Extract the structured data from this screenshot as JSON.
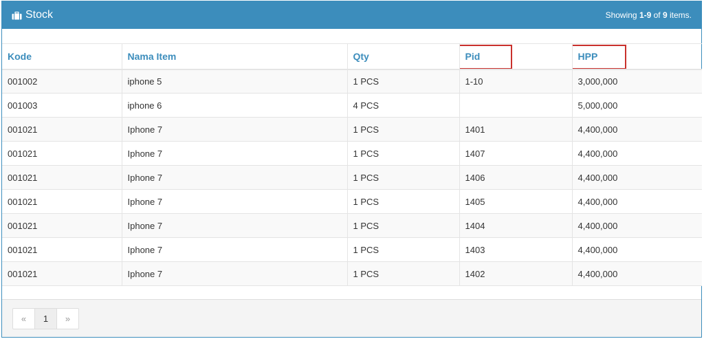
{
  "panel": {
    "title": "Stock",
    "icon": "briefcase-icon",
    "summary": {
      "prefix": "Showing ",
      "range": "1-9",
      "middle": " of ",
      "total": "9",
      "suffix": " items."
    }
  },
  "table": {
    "columns": [
      "Kode",
      "Nama Item",
      "Qty",
      "Pid",
      "HPP"
    ],
    "highlighted_columns": [
      "Pid",
      "HPP"
    ],
    "rows": [
      [
        "001002",
        "iphone 5",
        "1 PCS",
        "1-10",
        "3,000,000"
      ],
      [
        "001003",
        "iphone 6",
        "4 PCS",
        "",
        "5,000,000"
      ],
      [
        "001021",
        "Iphone 7",
        "1 PCS",
        "1401",
        "4,400,000"
      ],
      [
        "001021",
        "Iphone 7",
        "1 PCS",
        "1407",
        "4,400,000"
      ],
      [
        "001021",
        "Iphone 7",
        "1 PCS",
        "1406",
        "4,400,000"
      ],
      [
        "001021",
        "Iphone 7",
        "1 PCS",
        "1405",
        "4,400,000"
      ],
      [
        "001021",
        "Iphone 7",
        "1 PCS",
        "1404",
        "4,400,000"
      ],
      [
        "001021",
        "Iphone 7",
        "1 PCS",
        "1403",
        "4,400,000"
      ],
      [
        "001021",
        "Iphone 7",
        "1 PCS",
        "1402",
        "4,400,000"
      ]
    ]
  },
  "pagination": {
    "prev": "«",
    "pages": [
      "1"
    ],
    "current": "1",
    "next": "»"
  },
  "colors": {
    "primary": "#3c8dbc",
    "highlight": "#c9302c"
  }
}
